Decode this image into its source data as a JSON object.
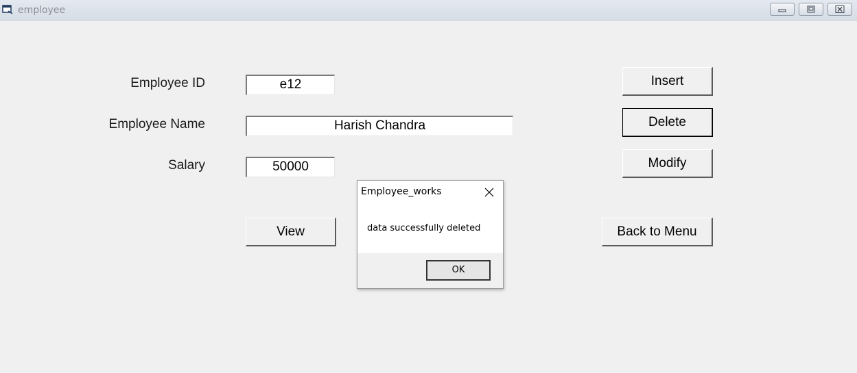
{
  "window": {
    "title": "employee",
    "icon": "app-form-icon",
    "controls": [
      "minimize-icon",
      "maximize-icon",
      "close-icon"
    ]
  },
  "form": {
    "employee_id_label": "Employee ID",
    "employee_id_value": "e12",
    "employee_name_label": "Employee Name",
    "employee_name_value": "Harish Chandra",
    "salary_label": "Salary",
    "salary_value": "50000"
  },
  "buttons": {
    "insert": "Insert",
    "delete": "Delete",
    "modify": "Modify",
    "view": "View",
    "back_to_menu": "Back to Menu"
  },
  "dialog": {
    "title": "Employee_works",
    "message": "data successfully deleted",
    "ok": "OK"
  }
}
